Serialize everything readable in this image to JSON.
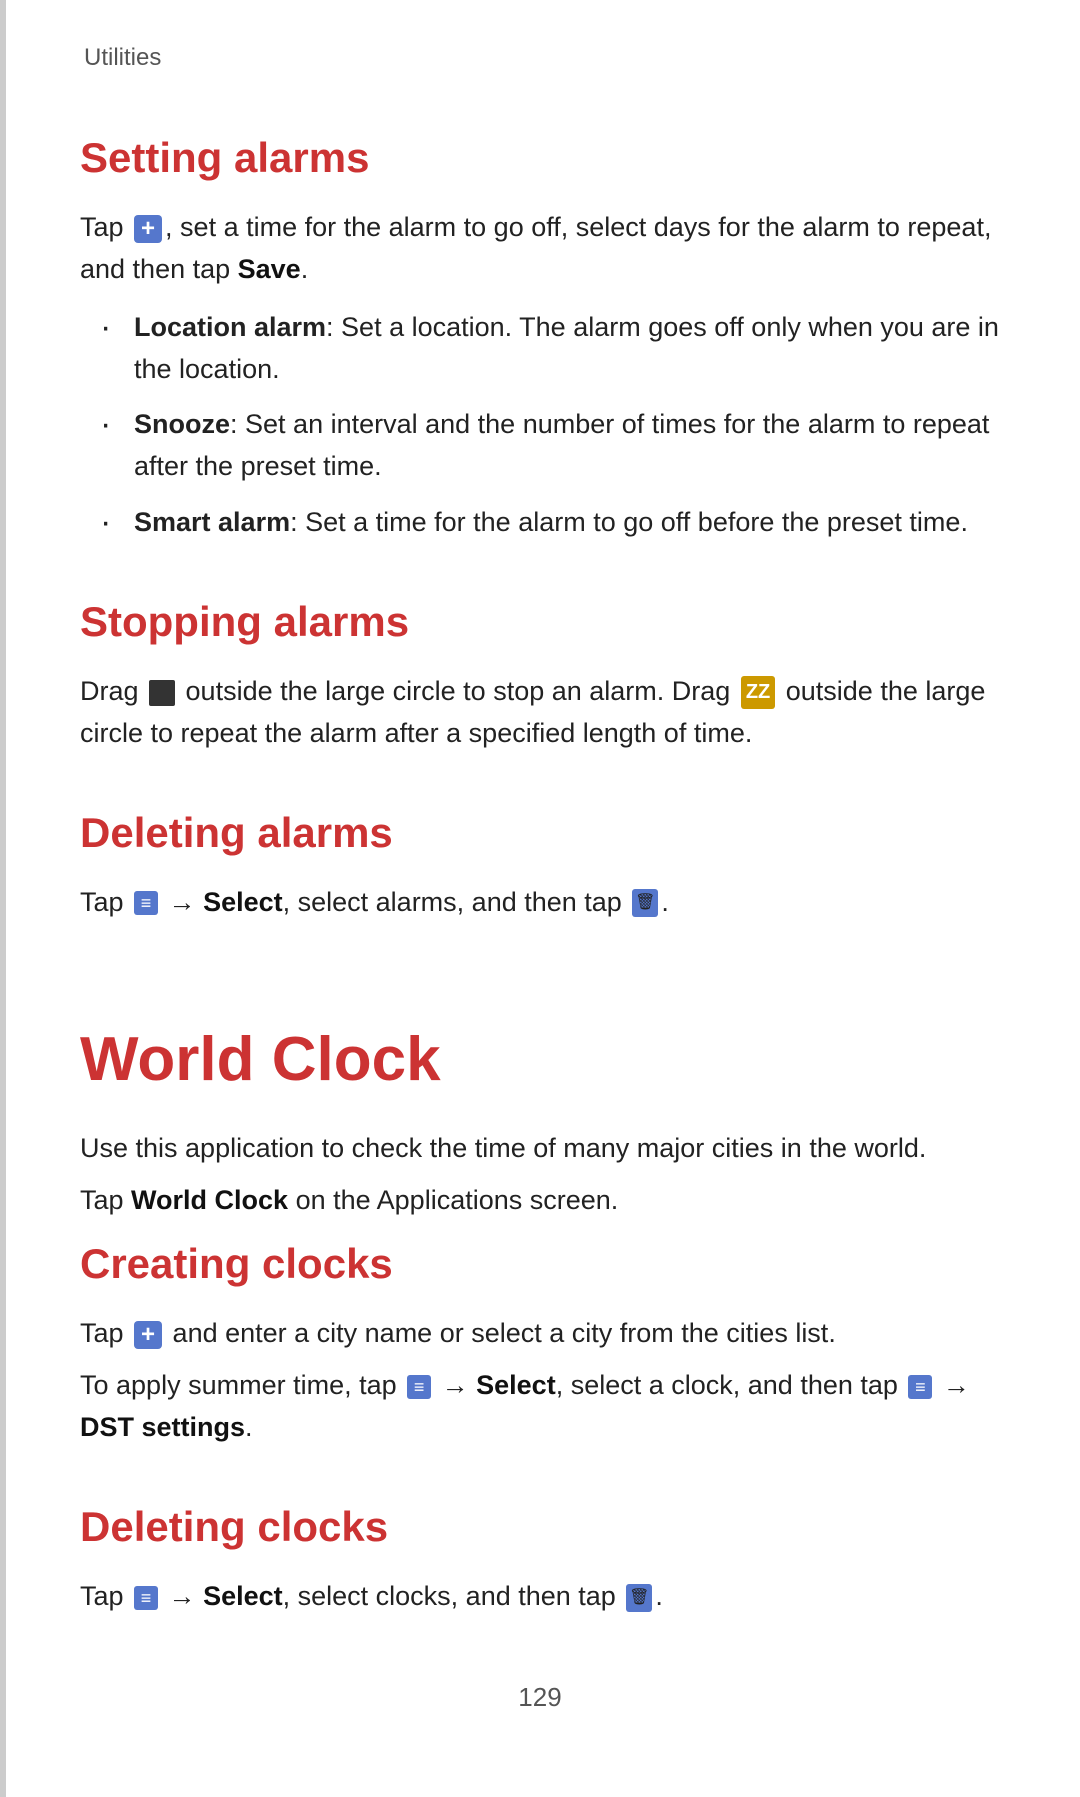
{
  "page": {
    "breadcrumb": "Utilities",
    "page_number": "129"
  },
  "sections": {
    "setting_alarms": {
      "heading": "Setting alarms",
      "intro": "Tap  , set a time for the alarm to go off, select days for the alarm to repeat, and then tap Save.",
      "save_bold": "Save",
      "bullets": [
        {
          "label": "Location alarm",
          "text": ": Set a location. The alarm goes off only when you are in the location."
        },
        {
          "label": "Snooze",
          "text": ": Set an interval and the number of times for the alarm to repeat after the preset time."
        },
        {
          "label": "Smart alarm",
          "text": ": Set a time for the alarm to go off before the preset time."
        }
      ]
    },
    "stopping_alarms": {
      "heading": "Stopping alarms",
      "text1": "Drag  outside the large circle to stop an alarm. Drag  outside the large circle to repeat the alarm after a specified length of time."
    },
    "deleting_alarms": {
      "heading": "Deleting alarms",
      "text": "Tap  → Select, select alarms, and then tap  .",
      "select_bold": "Select"
    },
    "world_clock": {
      "heading": "World Clock",
      "intro1": "Use this application to check the time of many major cities in the world.",
      "intro2": "Tap World Clock on the Applications screen.",
      "world_clock_bold": "World Clock"
    },
    "creating_clocks": {
      "heading": "Creating clocks",
      "text1": "Tap  and enter a city name or select a city from the cities list.",
      "text2": "To apply summer time, tap  → Select, select a clock, and then tap  → DST settings.",
      "select_bold": "Select",
      "dst_bold": "DST settings"
    },
    "deleting_clocks": {
      "heading": "Deleting clocks",
      "text": "Tap  → Select, select clocks, and then tap  .",
      "select_bold": "Select"
    }
  }
}
